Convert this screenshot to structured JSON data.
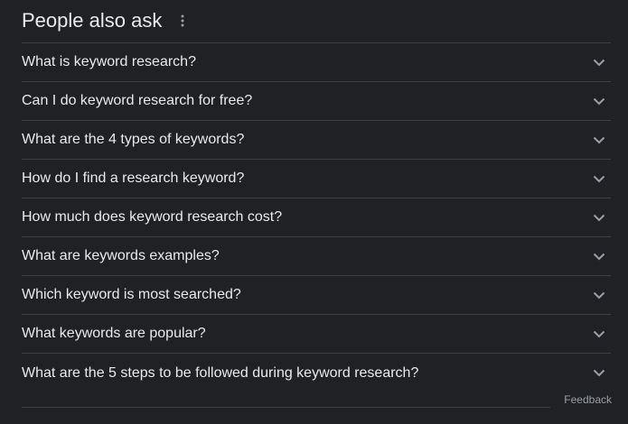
{
  "paa": {
    "title": "People also ask",
    "menu_icon": "more-vert-icon",
    "expand_icon": "chevron-down-icon",
    "questions": [
      "What is keyword research?",
      "Can I do keyword research for free?",
      "What are the 4 types of keywords?",
      "How do I find a research keyword?",
      "How much does keyword research cost?",
      "What are keywords examples?",
      "Which keyword is most searched?",
      "What keywords are popular?",
      "What are the 5 steps to be followed during keyword research?"
    ]
  },
  "footer": {
    "feedback_label": "Feedback"
  },
  "colors": {
    "background": "#202124",
    "text_primary": "#e8eaed",
    "text_secondary": "#9aa0a6",
    "divider": "#3c4043",
    "icon": "#9aa0a6"
  }
}
